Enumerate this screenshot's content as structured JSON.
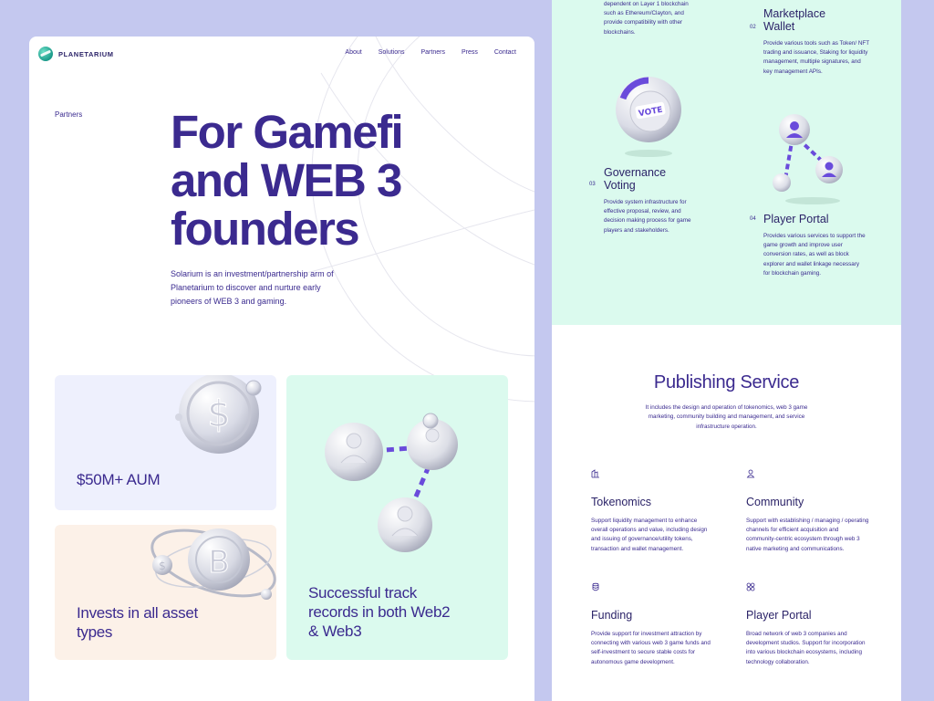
{
  "left": {
    "brand": "PLANETARIUM",
    "nav": [
      "About",
      "Solutions",
      "Partners",
      "Press",
      "Contact"
    ],
    "eyebrow": "Partners",
    "hero_title": "For Gamefi\nand WEB 3\nfounders",
    "hero_desc": "Solarium is an investment/partnership arm of Planetarium to discover and nurture early pioneers of WEB 3 and gaming.",
    "tiles": {
      "aum": "$50M+ AUM",
      "invest": "Invests in all asset\ntypes",
      "track": "Successful track\nrecords in both Web2\n& Web3"
    }
  },
  "right": {
    "intro_desc": "dependent on Layer 1 blockchain such as Ethereum/Clayton, and provide compatibility with other blockchains.",
    "features": [
      {
        "num": "02",
        "title": "Marketplace\nWallet",
        "desc": "Provide various tools such as Token/ NFT trading and issuance, Staking for liquidity management, multiple signatures, and key management APIs."
      },
      {
        "num": "03",
        "title": "Governance\nVoting",
        "desc": "Provide system infrastructure for effective proposal, review, and decision making process for game players and stakeholders."
      },
      {
        "num": "04",
        "title": "Player Portal",
        "desc": "Provides various services to support the game growth and improve user conversion rates, as well as block explorer and wallet linkage necessary for blockchain gaming."
      }
    ],
    "vote_text": "VOTE",
    "publishing": {
      "title": "Publishing Service",
      "desc": "It includes the design and operation of tokenomics, web 3 game marketing, community building and management, and service infrastructure operation.",
      "services": [
        {
          "icon": "chart-icon",
          "title": "Tokenomics",
          "desc": "Support liquidity management to enhance overall operations and value, including design and issuing of governance/utility tokens, transaction and wallet management."
        },
        {
          "icon": "user-icon",
          "title": "Community",
          "desc": "Support with establishing / managing / operating channels for efficient acquisition and community-centric ecosystem through web 3 native marketing and communications."
        },
        {
          "icon": "coins-icon",
          "title": "Funding",
          "desc": "Provide support for investment attraction by connecting with various web 3 game funds and self-investment to secure stable costs for autonomous game development."
        },
        {
          "icon": "grid-icon",
          "title": "Player Portal",
          "desc": "Broad network of web 3 companies and development studios. Support for incorporation into various blockchain ecosystems, including technology collaboration."
        }
      ]
    }
  },
  "colors": {
    "page_bg": "#c4c8ef",
    "primary_text": "#3b2a8f",
    "mint": "#dbfaee",
    "lavender_tile": "#eef0fd",
    "peach_tile": "#fcf1e8",
    "accent_purple": "#6a4bdb"
  }
}
